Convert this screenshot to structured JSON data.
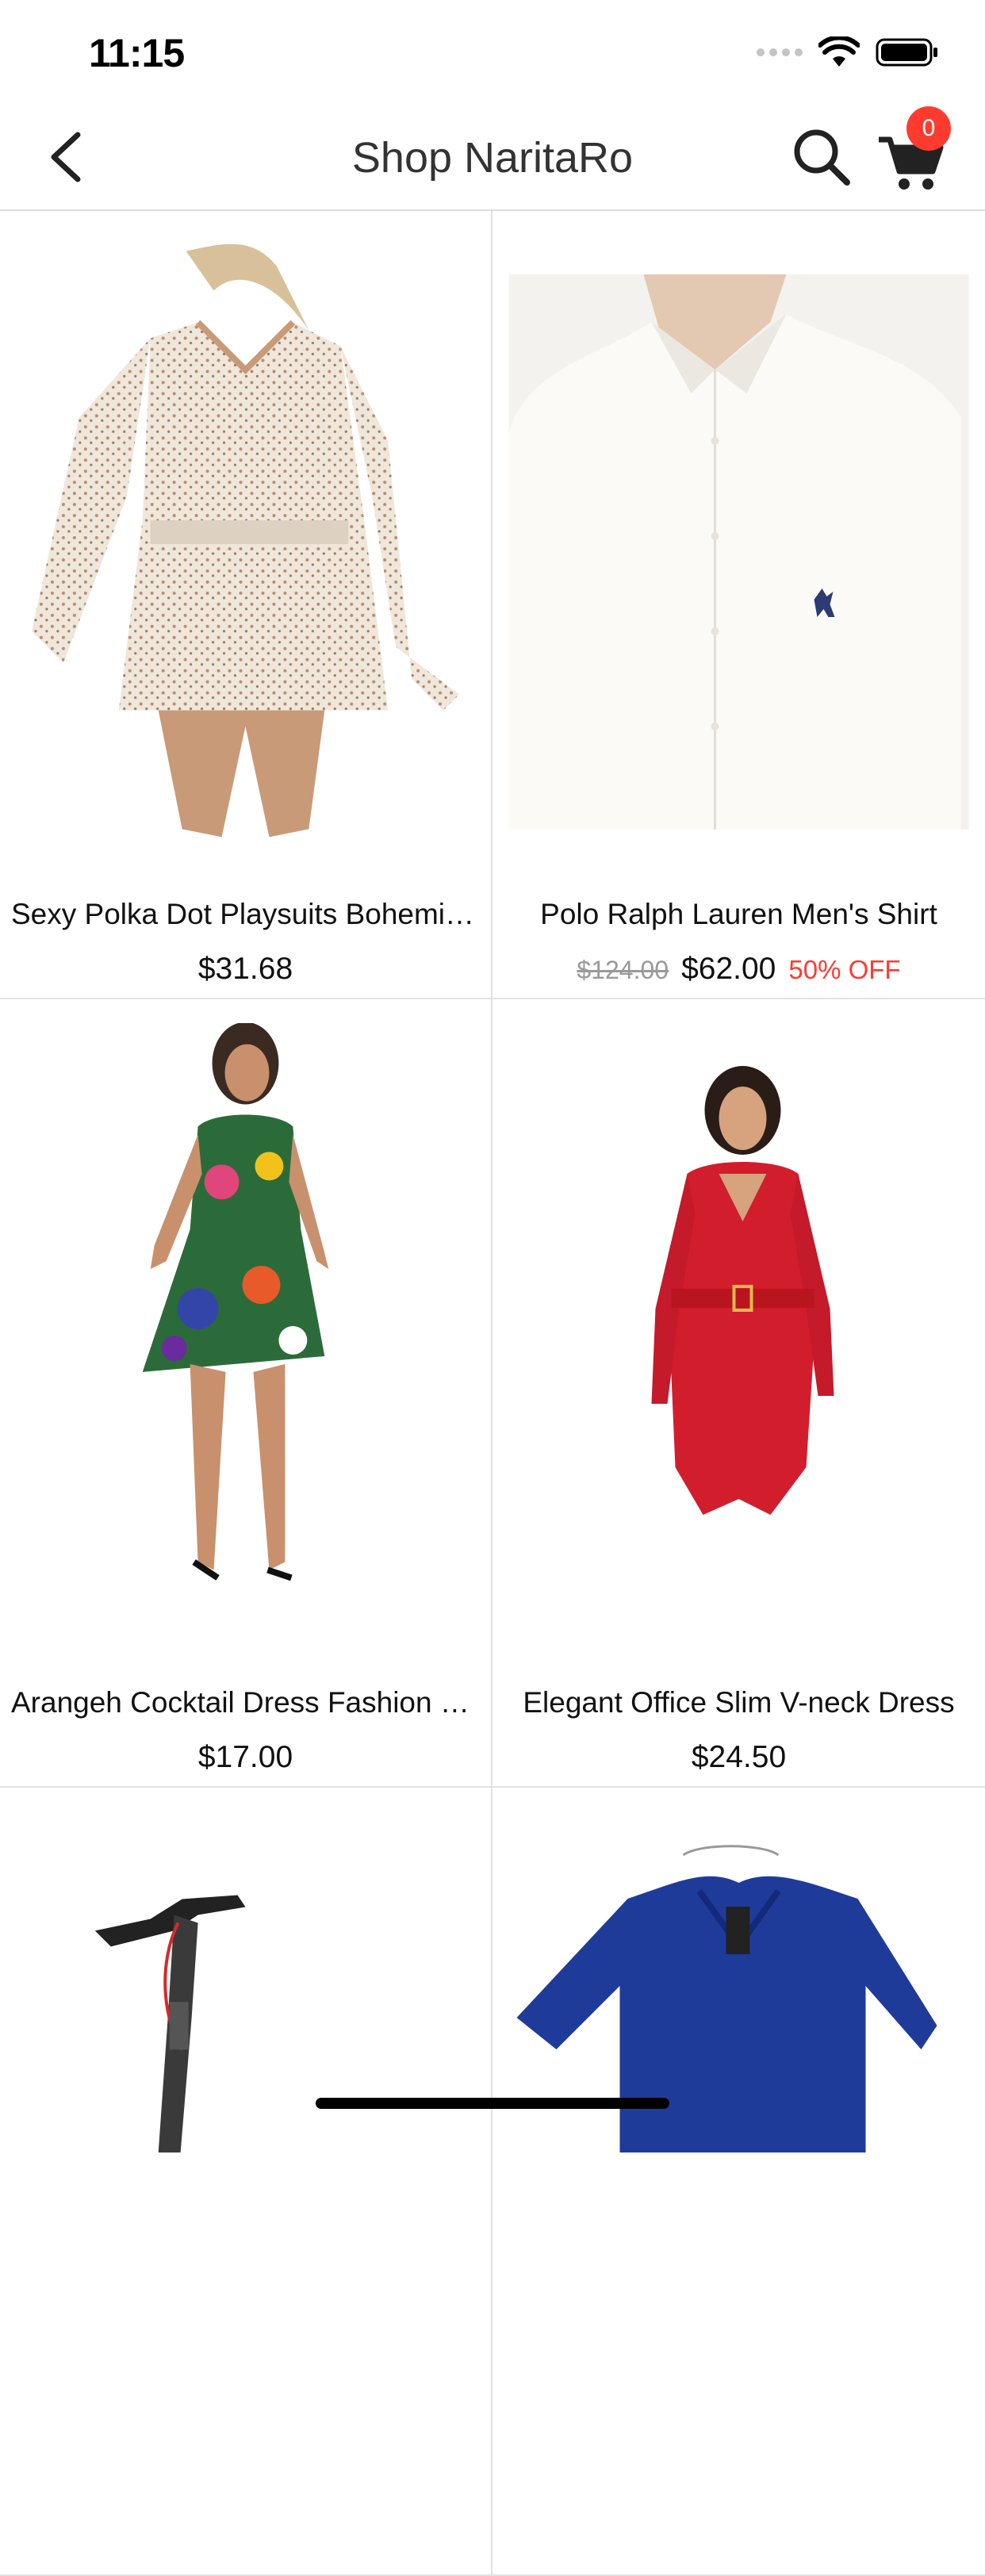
{
  "status_bar": {
    "time": "11:15",
    "icons": [
      "signal-dots-icon",
      "wifi-icon",
      "battery-icon"
    ]
  },
  "nav": {
    "title": "Shop NaritaRo",
    "back_icon": "chevron-left-icon",
    "search_icon": "search-icon",
    "cart_icon": "cart-icon",
    "cart_count": "0"
  },
  "products": [
    {
      "name": "Sexy Polka Dot Playsuits Bohemia...",
      "price": "$31.68",
      "old_price": "",
      "discount": "",
      "image": "polka-dot-romper"
    },
    {
      "name": "Polo Ralph Lauren Men's Shirt",
      "price": "$62.00",
      "old_price": "$124.00",
      "discount": "50% OFF",
      "image": "white-shirt"
    },
    {
      "name": "Arangeh Cocktail Dress Fashion 2...",
      "price": "$17.00",
      "old_price": "",
      "discount": "",
      "image": "floral-dress"
    },
    {
      "name": "Elegant Office Slim V-neck Dress",
      "price": "$24.50",
      "old_price": "",
      "discount": "",
      "image": "red-dress"
    },
    {
      "name": "",
      "price": "",
      "old_price": "",
      "discount": "",
      "image": "scooter"
    },
    {
      "name": "",
      "price": "",
      "old_price": "",
      "discount": "",
      "image": "blue-dress"
    }
  ],
  "colors": {
    "accent": "#ff3b30",
    "title": "#333333",
    "divider": "#e2e2e2"
  }
}
